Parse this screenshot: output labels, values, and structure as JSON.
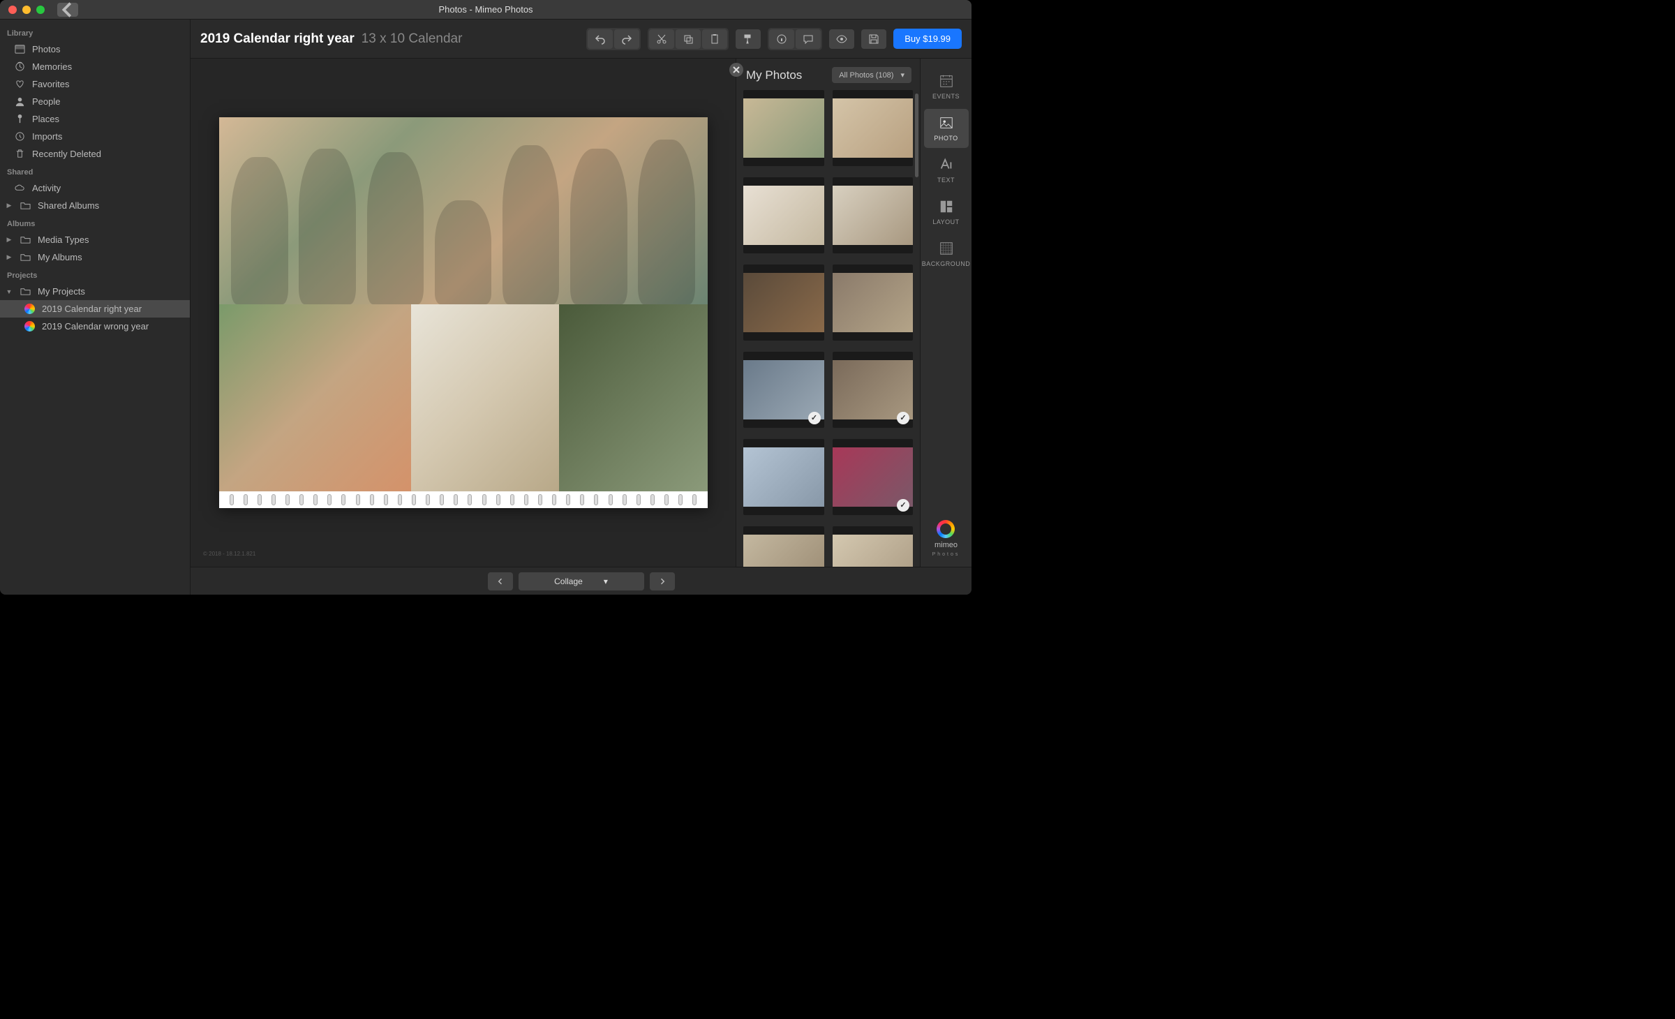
{
  "window": {
    "title": "Photos - Mimeo Photos"
  },
  "sidebar": {
    "sections": {
      "library": {
        "header": "Library"
      },
      "shared": {
        "header": "Shared"
      },
      "albums": {
        "header": "Albums"
      },
      "projects": {
        "header": "Projects"
      }
    },
    "items": {
      "photos": "Photos",
      "memories": "Memories",
      "favorites": "Favorites",
      "people": "People",
      "places": "Places",
      "imports": "Imports",
      "recently_deleted": "Recently Deleted",
      "activity": "Activity",
      "shared_albums": "Shared Albums",
      "media_types": "Media Types",
      "my_albums": "My Albums",
      "my_projects": "My Projects",
      "project1": "2019 Calendar right year",
      "project2": "2019 Calendar wrong year"
    }
  },
  "toolbar": {
    "project_title": "2019 Calendar right year",
    "project_subtitle": "13 x 10 Calendar",
    "buy_label": "Buy $19.99"
  },
  "pager": {
    "mode_label": "Collage"
  },
  "canvas": {
    "watermark": "© 2018 - 18.12.1.821"
  },
  "photo_panel": {
    "title": "My Photos",
    "filter_label": "All Photos (108)",
    "thumbnails": [
      {
        "id": "t1",
        "used": false
      },
      {
        "id": "t2",
        "used": false
      },
      {
        "id": "t3",
        "used": false
      },
      {
        "id": "t4",
        "used": false
      },
      {
        "id": "t5",
        "used": false
      },
      {
        "id": "t6",
        "used": false
      },
      {
        "id": "t7",
        "used": true
      },
      {
        "id": "t8",
        "used": true
      },
      {
        "id": "t9",
        "used": false
      },
      {
        "id": "t10",
        "used": true
      },
      {
        "id": "t11",
        "used": false
      },
      {
        "id": "t12",
        "used": false
      }
    ]
  },
  "tools_rail": {
    "events": "EVENTS",
    "photo": "PHOTO",
    "text": "TEXT",
    "layout": "LAYOUT",
    "background": "BACKGROUND",
    "brand": "mimeo",
    "brand_sub": "Photos"
  }
}
